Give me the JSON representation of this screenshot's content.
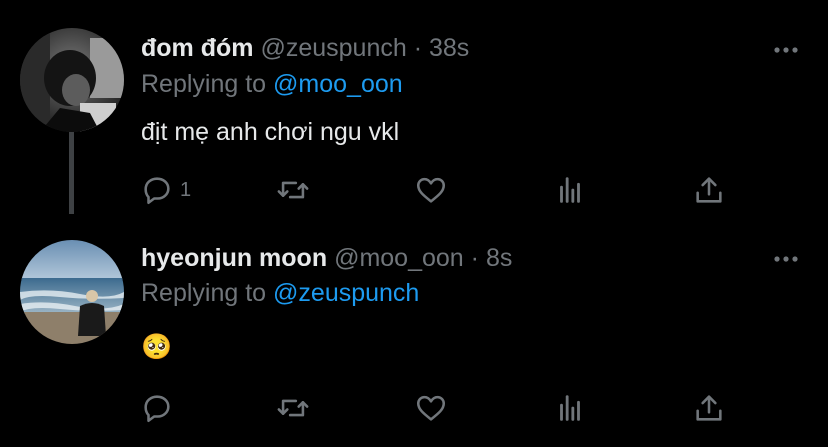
{
  "colors": {
    "background": "#000000",
    "text": "#e7e9ea",
    "muted": "#71767b",
    "link": "#1d9bf0",
    "thread_line": "#3e4144"
  },
  "tweets": [
    {
      "name": "đom đóm",
      "handle": "@zeuspunch",
      "separator": "·",
      "time": "38s",
      "replying_prefix": "Replying to ",
      "replying_to": "@moo_oon",
      "text": "địt mẹ anh chơi ngu vkl",
      "reply_count": "1",
      "icons": [
        "reply-icon",
        "retweet-icon",
        "like-icon",
        "analytics-icon",
        "share-icon",
        "more-icon"
      ]
    },
    {
      "name": "hyeonjun moon",
      "handle": "@moo_oon",
      "separator": "·",
      "time": "8s",
      "replying_prefix": "Replying to ",
      "replying_to": "@zeuspunch",
      "text": "🥺",
      "reply_count": "",
      "icons": [
        "reply-icon",
        "retweet-icon",
        "like-icon",
        "analytics-icon",
        "share-icon",
        "more-icon"
      ]
    }
  ]
}
